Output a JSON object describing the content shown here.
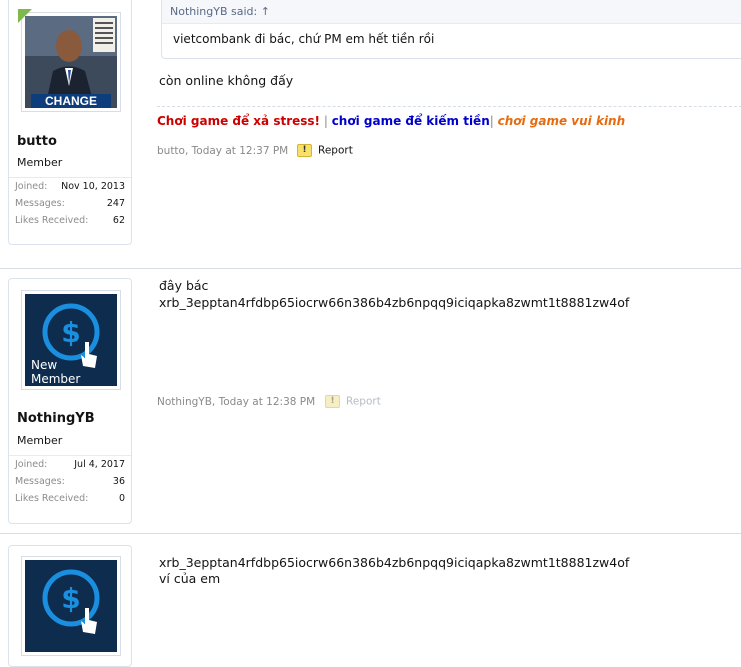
{
  "posts": [
    {
      "user": {
        "name": "butto",
        "title": "Member",
        "joined_label": "Joined:",
        "joined": "Nov 10, 2013",
        "messages_label": "Messages:",
        "messages": "247",
        "likes_label": "Likes Received:",
        "likes": "62",
        "avatar_text": "CHANGE"
      },
      "quote": {
        "author": "NothingYB said: ↑",
        "text": "vietcombank đi bác, chứ PM em hết tiền rồi"
      },
      "message": [
        "còn online không đấy"
      ],
      "signature": {
        "part1": "Chơi game để xả stress!",
        "sep1": " | ",
        "part2": "chơi game để kiếm tiền",
        "sep2": "| ",
        "part3": "chơi game vui kinh"
      },
      "meta": "butto, Today at 12:37 PM",
      "report": "Report"
    },
    {
      "user": {
        "name": "NothingYB",
        "title": "Member",
        "joined_label": "Joined:",
        "joined": "Jul 4, 2017",
        "messages_label": "Messages:",
        "messages": "36",
        "likes_label": "Likes Received:",
        "likes": "0",
        "avatar_text1": "New",
        "avatar_text2": "Member"
      },
      "message": [
        "đây bác",
        "xrb_3epptan4rfdbp65iocrw66n386b4zb6npqq9iciqapka8zwmt1t8881zw4of"
      ],
      "meta": "NothingYB, Today at 12:38 PM",
      "report": "Report"
    },
    {
      "message": [
        "xrb_3epptan4rfdbp65iocrw66n386b4zb6npqq9iciqapka8zwmt1t8881zw4of",
        "ví của em"
      ]
    }
  ],
  "colors": {
    "sig_red": "#cc0000",
    "sig_blue": "#0000cc",
    "sig_orange": "#e86a10",
    "link_blue": "#2577b1"
  }
}
